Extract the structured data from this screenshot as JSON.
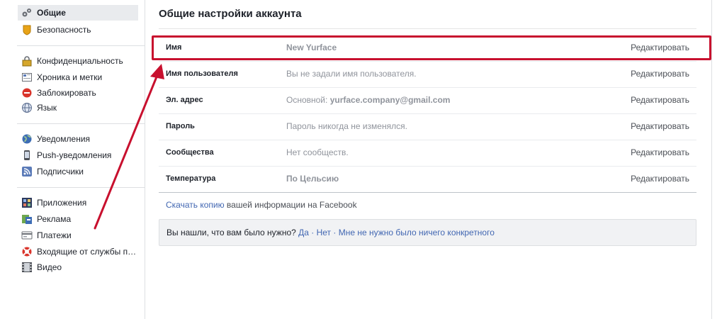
{
  "sidebar": {
    "items": [
      {
        "label": "Общие",
        "icon": "gears-icon",
        "selected": true
      },
      {
        "label": "Безопасность",
        "icon": "badge-icon"
      },
      {
        "label": "Конфиденциальность",
        "icon": "lock-icon"
      },
      {
        "label": "Хроника и метки",
        "icon": "timeline-icon"
      },
      {
        "label": "Заблокировать",
        "icon": "block-icon"
      },
      {
        "label": "Язык",
        "icon": "globe-icon"
      },
      {
        "label": "Уведомления",
        "icon": "world-icon"
      },
      {
        "label": "Push-уведомления",
        "icon": "phone-icon"
      },
      {
        "label": "Подписчики",
        "icon": "rss-icon"
      },
      {
        "label": "Приложения",
        "icon": "apps-icon"
      },
      {
        "label": "Реклама",
        "icon": "ads-icon"
      },
      {
        "label": "Платежи",
        "icon": "card-icon"
      },
      {
        "label": "Входящие от службы п…",
        "icon": "lifebuoy-icon"
      },
      {
        "label": "Видео",
        "icon": "film-icon"
      }
    ]
  },
  "main": {
    "title": "Общие настройки аккаунта",
    "edit_label": "Редактировать",
    "rows": [
      {
        "label": "Имя",
        "value": "New Yurface",
        "value_bold": true
      },
      {
        "label": "Имя пользователя",
        "value": "Вы не задали имя пользователя."
      },
      {
        "label": "Эл. адрес",
        "value_prefix": "Основной: ",
        "value": "yurface.company@gmail.com"
      },
      {
        "label": "Пароль",
        "value": "Пароль никогда не изменялся."
      },
      {
        "label": "Сообщества",
        "value": "Нет сообществ."
      },
      {
        "label": "Температура",
        "value": "По Цельсию",
        "value_bold": true
      }
    ],
    "download": {
      "link": "Скачать копию",
      "rest": " вашей информации на Facebook"
    },
    "feedback": {
      "question": "Вы нашли, что вам было нужно? ",
      "yes": "Да",
      "sep": " · ",
      "no": "Нет",
      "other": "Мне не нужно было ничего конкретного"
    }
  },
  "colors": {
    "accent": "#4267b2",
    "annotation": "#c8102e"
  }
}
